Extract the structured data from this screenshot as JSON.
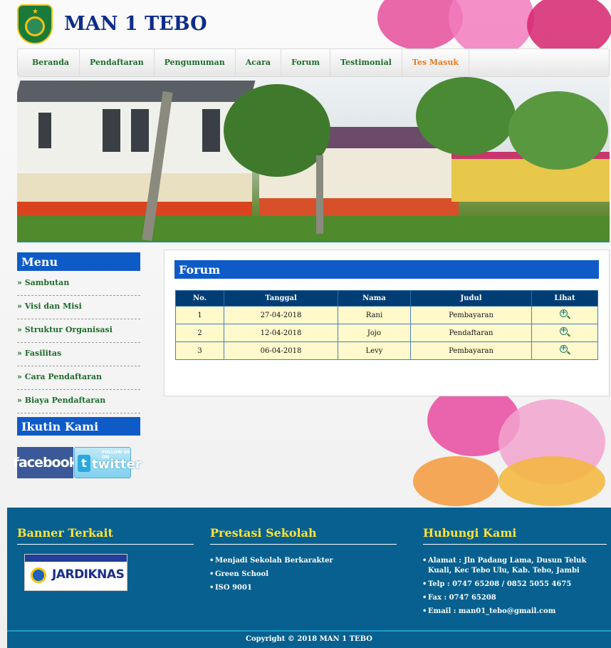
{
  "site": {
    "title": "MAN 1 TEBO"
  },
  "nav": {
    "items": [
      "Beranda",
      "Pendaftaran",
      "Pengumuman",
      "Acara",
      "Forum",
      "Testimonial",
      "Tes Masuk"
    ],
    "active": "Tes Masuk"
  },
  "sidebar": {
    "menu_title": "Menu",
    "items": [
      "» Sambutan",
      "» Visi dan Misi",
      "» Struktur Organisasi",
      "» Fasilitas",
      "» Cara Pendaftaran",
      "» Biaya Pendaftaran"
    ],
    "follow_title": "Ikutin Kami",
    "facebook_label": "facebook",
    "twitter_follow": "FOLLOW US ON",
    "twitter_label": "twitter"
  },
  "forum": {
    "title": "Forum",
    "columns": [
      "No.",
      "Tanggal",
      "Nama",
      "Judul",
      "Lihat"
    ],
    "rows": [
      {
        "no": "1",
        "tanggal": "27-04-2018",
        "nama": "Rani",
        "judul": "Pembayaran"
      },
      {
        "no": "2",
        "tanggal": "12-04-2018",
        "nama": "Jojo",
        "judul": "Pendaftaran"
      },
      {
        "no": "3",
        "tanggal": "06-04-2018",
        "nama": "Levy",
        "judul": "Pembayaran"
      }
    ]
  },
  "footer": {
    "banner_title": "Banner Terkait",
    "banner_logo_text": "JARDIKNAS",
    "prestasi_title": "Prestasi Sekolah",
    "prestasi_items": [
      "Menjadi Sekolah Berkarakter",
      "Green School",
      "ISO 9001"
    ],
    "kontak_title": "Hubungi Kami",
    "kontak_items": [
      "Alamat : Jln Padang Lama, Dusun Teluk Kuali, Kec Tebo Ulu, Kab. Tebo, Jambi",
      "Telp : 0747 65208 / 0852 5055 4675",
      "Fax : 0747 65208",
      "Email : man01_tebo@gmail.com"
    ],
    "copyright": "Copyright © 2018 MAN 1 TEBO"
  },
  "colors": {
    "accent_blue": "#0e5bc7",
    "footer_blue": "#07608f",
    "nav_green": "#1e6b2a",
    "nav_active": "#e6781e",
    "footer_heading": "#ffe23a"
  }
}
